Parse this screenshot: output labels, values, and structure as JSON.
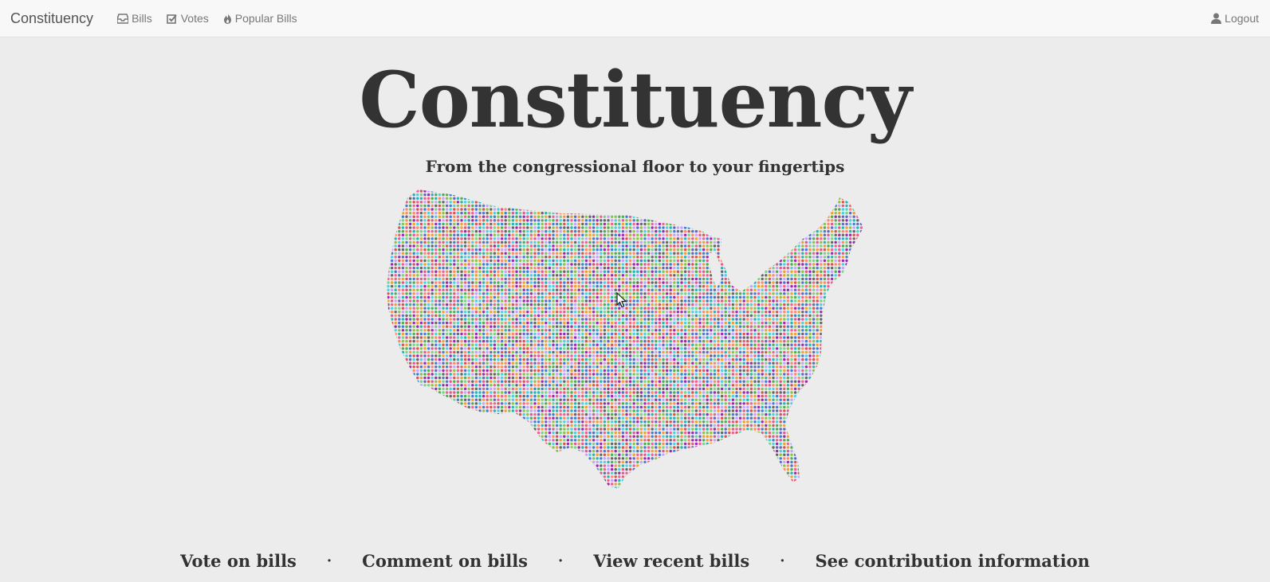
{
  "navbar": {
    "brand": "Constituency",
    "links": [
      {
        "label": "Bills",
        "icon": "inbox-icon"
      },
      {
        "label": "Votes",
        "icon": "check-square-icon"
      },
      {
        "label": "Popular Bills",
        "icon": "fire-icon"
      }
    ],
    "logout": {
      "label": "Logout",
      "icon": "user-icon"
    }
  },
  "hero": {
    "title": "Constituency",
    "subtitle": "From the congressional floor to your fingertips"
  },
  "map": {
    "colors": [
      "#e05a8a",
      "#4caf50",
      "#3f7fd6",
      "#f0a030",
      "#9c27b0",
      "#26b5b5",
      "#d9534f",
      "#8bc34a",
      "#f06292",
      "#5c6bc0",
      "#7bd389",
      "#c9a0ff",
      "#ff8a65",
      "#4dd0e1",
      "#666666"
    ]
  },
  "features": [
    {
      "label": "Vote on bills"
    },
    {
      "label": "Comment on bills"
    },
    {
      "label": "View recent bills"
    },
    {
      "label": "See contribution information"
    }
  ],
  "separator": "·"
}
